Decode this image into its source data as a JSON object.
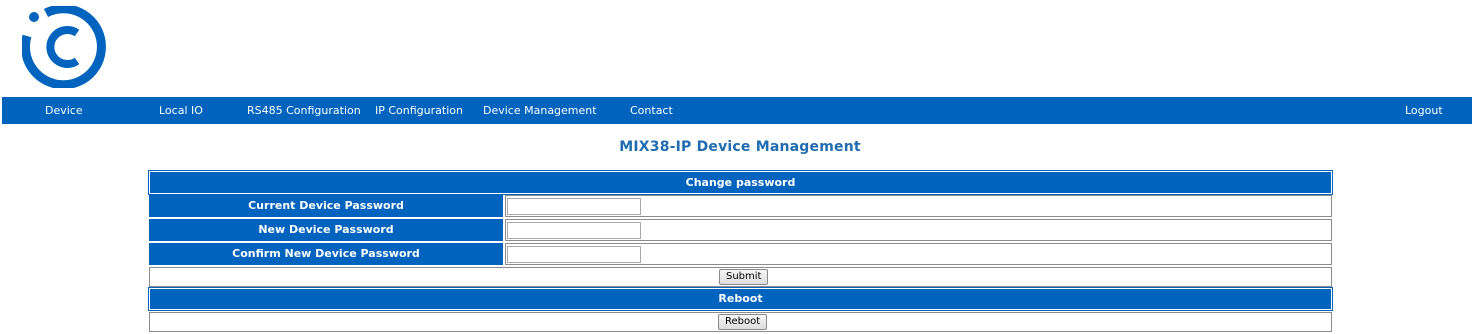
{
  "nav": {
    "items": [
      {
        "label": "Device"
      },
      {
        "label": "Local IO"
      },
      {
        "label": "RS485 Configuration"
      },
      {
        "label": "IP Configuration"
      },
      {
        "label": "Device Management"
      },
      {
        "label": "Contact"
      }
    ],
    "logout_label": "Logout"
  },
  "page": {
    "title": "MIX38-IP Device Management"
  },
  "change_password": {
    "header": "Change password",
    "fields": [
      {
        "label": "Current Device Password",
        "value": ""
      },
      {
        "label": "New Device Password",
        "value": ""
      },
      {
        "label": "Confirm New Device Password",
        "value": ""
      }
    ],
    "submit_label": "Submit"
  },
  "reboot": {
    "header": "Reboot",
    "button_label": "Reboot"
  },
  "colors": {
    "brand_blue": "#0063be",
    "title_blue": "#1f6cb0"
  },
  "logo": {
    "icon": "logo-icon"
  }
}
